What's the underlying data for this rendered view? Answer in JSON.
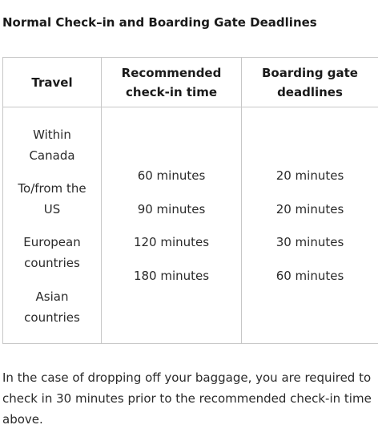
{
  "page": {
    "title": "Normal Check–in and Boarding Gate Deadlines"
  },
  "table": {
    "headers": {
      "travel": [
        "Travel"
      ],
      "checkin": [
        "Recommended",
        "check-in time"
      ],
      "boarding": [
        "Boarding gate",
        "deadlines"
      ]
    },
    "travel_entries": [
      [
        "Within",
        "Canada"
      ],
      [
        "To/from the",
        "US"
      ],
      [
        "European",
        "countries"
      ],
      [
        "Asian",
        "countries"
      ]
    ],
    "checkin_times": [
      "60 minutes",
      "90 minutes",
      "120 minutes",
      "180 minutes"
    ],
    "boarding_deadlines": [
      "20 minutes",
      "20 minutes",
      "30 minutes",
      "60 minutes"
    ]
  },
  "note": {
    "text": "In the case of dropping off your baggage, you are required to check in 30 minutes prior to the recommended check-in time above."
  },
  "colors": {
    "border": "#c7c7c7",
    "text": "#2a2a2a",
    "heading": "#1a1a1a"
  }
}
